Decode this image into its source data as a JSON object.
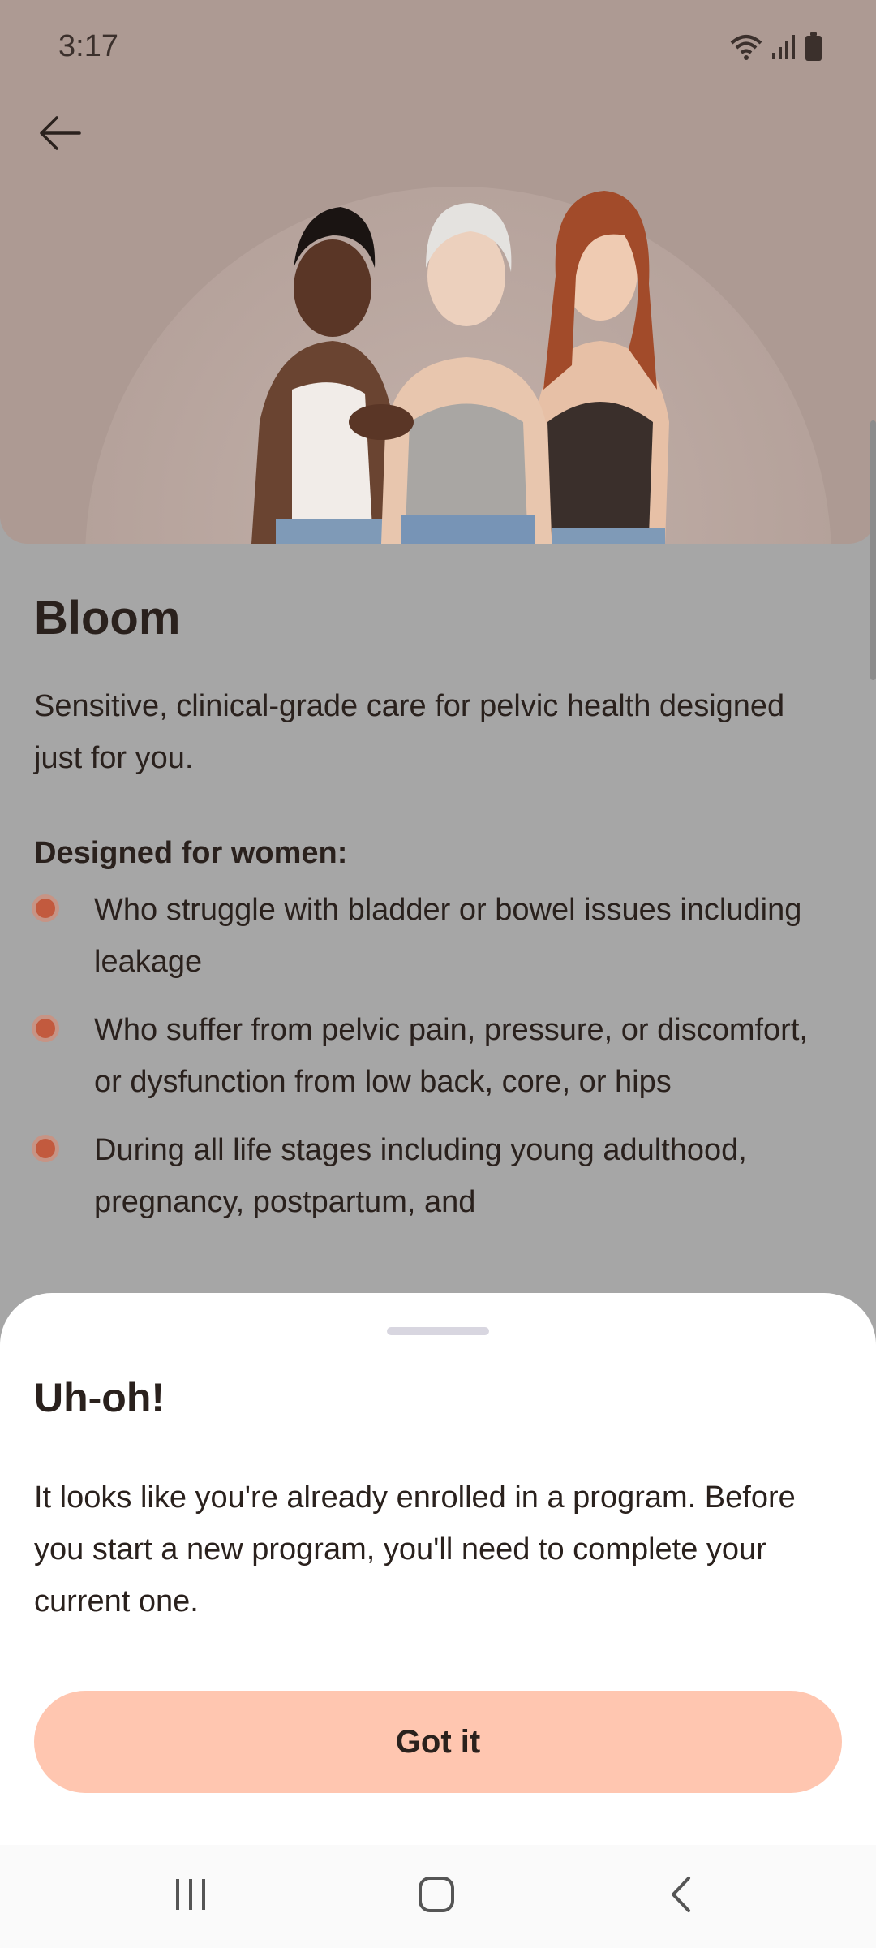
{
  "status_bar": {
    "time": "3:17",
    "icons": [
      "wifi-icon",
      "signal-icon",
      "battery-icon"
    ]
  },
  "header": {
    "back_icon": "arrow-left-icon"
  },
  "hero": {
    "image": "three-women-photo"
  },
  "program": {
    "title": "Bloom",
    "description": "Sensitive, clinical-grade care for pelvic health designed just for you.",
    "designed_for_heading": "Designed for women:",
    "bullets": [
      "Who struggle with bladder or bowel issues including leakage",
      "Who suffer from pelvic pain, pressure, or discomfort, or dysfunction from low back, core, or hips",
      "During all life stages including young adulthood, pregnancy, postpartum, and"
    ]
  },
  "sheet": {
    "title": "Uh-oh!",
    "message": "It looks like you're already enrolled in a program. Before you start a new program, you'll need to complete your current one.",
    "button_label": "Got it"
  },
  "nav_bar": {
    "icons": [
      "recent-apps-icon",
      "home-icon",
      "back-icon"
    ]
  },
  "colors": {
    "hero_bg": "#ad9a93",
    "dimmed_bg": "#a6a6a6",
    "bullet": "#c25a3e",
    "button_bg": "#ffc6b0",
    "text": "#2a211d"
  }
}
